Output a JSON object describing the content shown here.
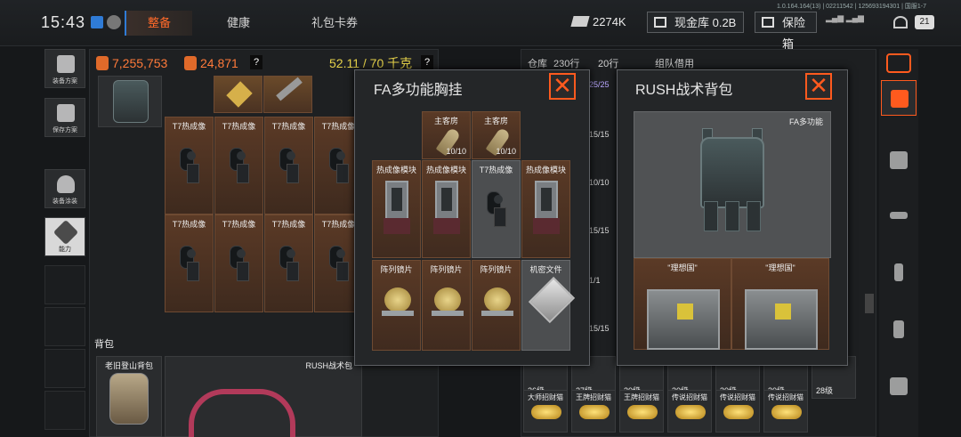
{
  "status": {
    "clock": "15:43",
    "build_info": "1.0.164.164(13) | 02211542 | 125693194301 | 国服1-7"
  },
  "tabs": [
    {
      "label": "整备",
      "active": true
    },
    {
      "label": "健康",
      "active": false
    },
    {
      "label": "礼包卡券",
      "active": false
    }
  ],
  "resources": {
    "ticket_value": "2274K",
    "vault_label": "现金库 0.2B",
    "insurance_label": "保险箱"
  },
  "sidebar": [
    {
      "label": "装备方案",
      "icon": "armor-icon"
    },
    {
      "label": "保存方案",
      "icon": "download-icon"
    },
    {
      "label": "装备涂装",
      "icon": "helmet-icon"
    },
    {
      "label": "能力",
      "icon": "ability-icon",
      "active": true
    }
  ],
  "inventory": {
    "currency_a": "7,255,753",
    "currency_b": "24,871",
    "weight": "52.11 / 70 千克",
    "help": "?",
    "scope_label": "T7热成像",
    "backpack_section": "背包",
    "backpack_items": [
      "老旧登山背包",
      "RUSH战术包"
    ]
  },
  "modal_chest": {
    "title": "FA多功能胸挂",
    "close": "✕",
    "items": [
      {
        "name": "主客房",
        "count": "10/10"
      },
      {
        "name": "主客房",
        "count": "10/10"
      },
      {
        "name": "热成像模块"
      },
      {
        "name": "热成像模块"
      },
      {
        "name": "T7热成像"
      },
      {
        "name": "热成像模块"
      },
      {
        "name": "阵列镜片"
      },
      {
        "name": "阵列镜片"
      },
      {
        "name": "阵列镜片"
      },
      {
        "name": "机密文件"
      }
    ]
  },
  "warehouse": {
    "tab_label": "仓库",
    "rows_a": "230行",
    "rows_b": "20行",
    "team_label": "组队借用",
    "strip": [
      "25/25",
      "15/15",
      "10/10",
      "15/15",
      "1/1",
      "15/15"
    ],
    "levels": [
      "26级",
      "27级",
      "30级",
      "30级",
      "30级",
      "30级",
      "28级"
    ],
    "coin_items": [
      "大师招财猫",
      "王牌招财猫",
      "王牌招财猫",
      "传说招财猫",
      "传说招财猫",
      "传说招财猫"
    ]
  },
  "modal_backpack": {
    "title": "RUSH战术背包",
    "close": "✕",
    "vest_label": "FA多功能",
    "crates": [
      "\"理想国\"",
      "\"理想国\""
    ]
  },
  "rightbar": [
    "sort-icon",
    "bag-icon",
    "vest-icon",
    "rifle-icon",
    "magazine-icon",
    "spray-icon",
    "gear-box-icon"
  ]
}
